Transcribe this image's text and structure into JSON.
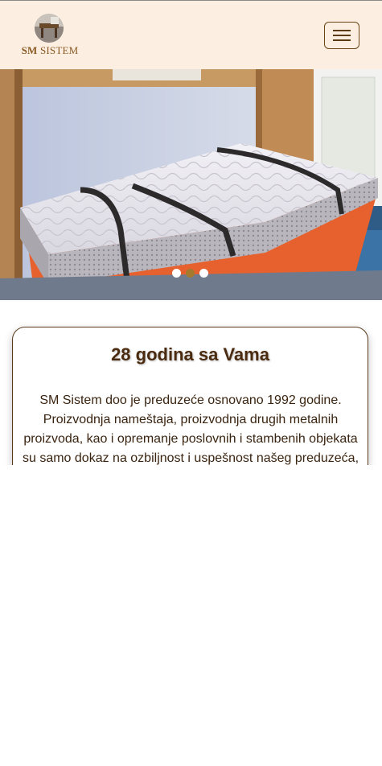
{
  "header": {
    "logo": {
      "brand_sm": "SM",
      "brand_rest": "SISTEM"
    },
    "menu_button": {
      "icon": "hamburger-icon"
    }
  },
  "hero": {
    "image": "mattress-on-bed-photo",
    "slides_count": 3,
    "active_slide": 2
  },
  "about": {
    "title": "28 godina sa Vama",
    "text": "SM Sistem doo je preduzeće osnovano 1992 godine. Proizvodnja nameštaja, proizvodnja drugih metalnih proizvoda, kao i opremanje poslovnih i stambenih objekata su samo dokaz na ozbiljnost i uspešnost našeg preduzeća,"
  },
  "colors": {
    "header_bg": "#fcefe2",
    "accent": "#a37a2e",
    "title": "#4a2b10"
  }
}
